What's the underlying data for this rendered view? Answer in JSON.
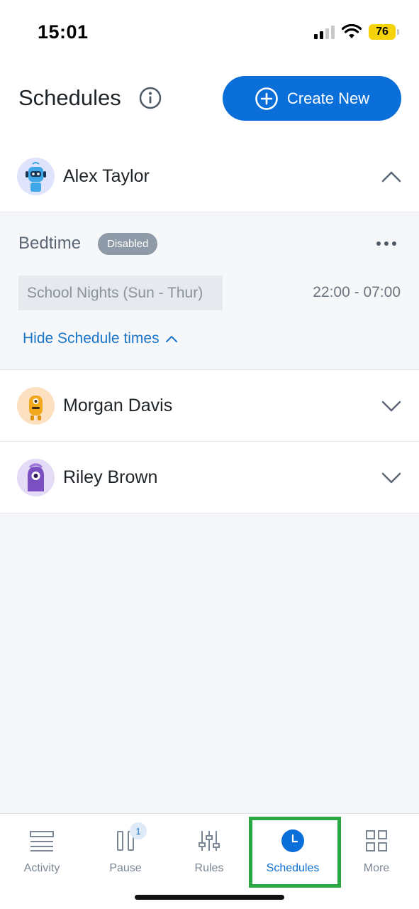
{
  "status_bar": {
    "time": "15:01",
    "battery": "76"
  },
  "header": {
    "title": "Schedules",
    "create_label": "Create New"
  },
  "members": [
    {
      "name": "Alex Taylor",
      "expanded": true
    },
    {
      "name": "Morgan Davis",
      "expanded": false
    },
    {
      "name": "Riley Brown",
      "expanded": false
    }
  ],
  "schedule": {
    "name": "Bedtime",
    "status": "Disabled",
    "days": "School Nights (Sun - Thur)",
    "time_range": "22:00 - 07:00",
    "hide_label": "Hide Schedule times"
  },
  "tabs": [
    {
      "label": "Activity",
      "icon": "activity-icon"
    },
    {
      "label": "Pause",
      "icon": "pause-icon",
      "badge": "1"
    },
    {
      "label": "Rules",
      "icon": "sliders-icon"
    },
    {
      "label": "Schedules",
      "icon": "clock-icon",
      "active": true
    },
    {
      "label": "More",
      "icon": "grid-icon"
    }
  ],
  "colors": {
    "accent": "#0b6fd9",
    "highlight": "#2aa846",
    "badge": "#8e9aa8"
  }
}
